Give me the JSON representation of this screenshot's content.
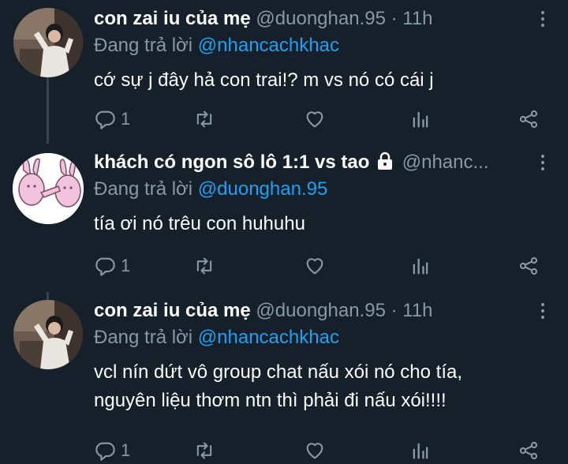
{
  "tweets": [
    {
      "name": "con zai iu của mẹ",
      "handle": "@duonghan.95",
      "sep": " · ",
      "time": "11h",
      "reply_prefix": "Đang trả lời ",
      "reply_to": "@nhancachkhac",
      "lines": [
        "cớ sự j đây hả con trai!? m vs nó có cái j"
      ],
      "reply_count": "1",
      "locked": false
    },
    {
      "name": "khách có ngon sô lô 1:1 vs tao",
      "handle": "@nhanc...",
      "sep": "",
      "time": "",
      "reply_prefix": "Đang trả lời ",
      "reply_to": "@duonghan.95",
      "lines": [
        "tía ơi nó trêu con huhuhu"
      ],
      "reply_count": "1",
      "locked": true
    },
    {
      "name": "con zai iu của mẹ",
      "handle": "@duonghan.95",
      "sep": " · ",
      "time": "11h",
      "reply_prefix": "Đang trả lời ",
      "reply_to": "@nhancachkhac",
      "lines": [
        "vcl nín dứt vô group chat nấu xói nó cho tía,",
        "nguyên liệu thơm ntn thì phải đi nấu xói!!!!"
      ],
      "reply_count": "1",
      "locked": false
    }
  ],
  "icons": {
    "reply": "reply-icon",
    "retweet": "retweet-icon",
    "like": "heart-icon",
    "stats": "stats-icon",
    "share": "share-icon",
    "more": "more-icon",
    "lock": "lock-icon"
  },
  "colors": {
    "background": "#15202b",
    "secondary_text": "#8899a6",
    "mention": "#1da1f2",
    "thread_line": "#38444d"
  }
}
